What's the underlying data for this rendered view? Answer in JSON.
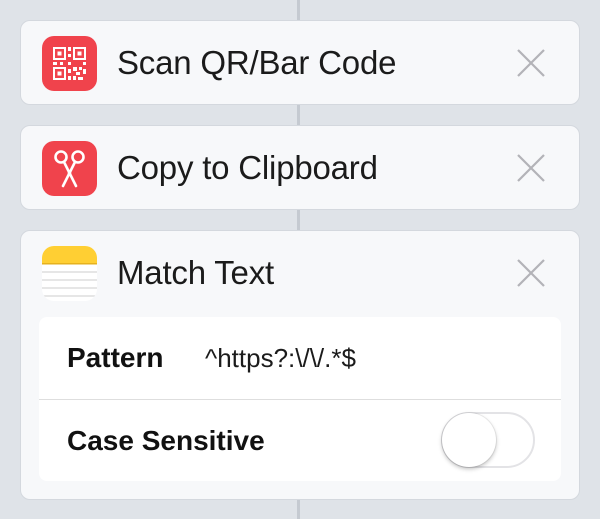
{
  "actions": [
    {
      "title": "Scan QR/Bar Code",
      "icon": "qr-code-icon",
      "icon_color": "#f0434c"
    },
    {
      "title": "Copy to Clipboard",
      "icon": "scissors-icon",
      "icon_color": "#f0434c"
    },
    {
      "title": "Match Text",
      "icon": "notes-icon",
      "icon_color": "#ffcf33",
      "parameters": {
        "pattern_label": "Pattern",
        "pattern_value": "^https?:\\/\\/.*$",
        "case_sensitive_label": "Case Sensitive",
        "case_sensitive": false
      }
    }
  ],
  "colors": {
    "background": "#dfe3e8",
    "card": "#f7f8fa",
    "accent_red": "#f0434c"
  }
}
